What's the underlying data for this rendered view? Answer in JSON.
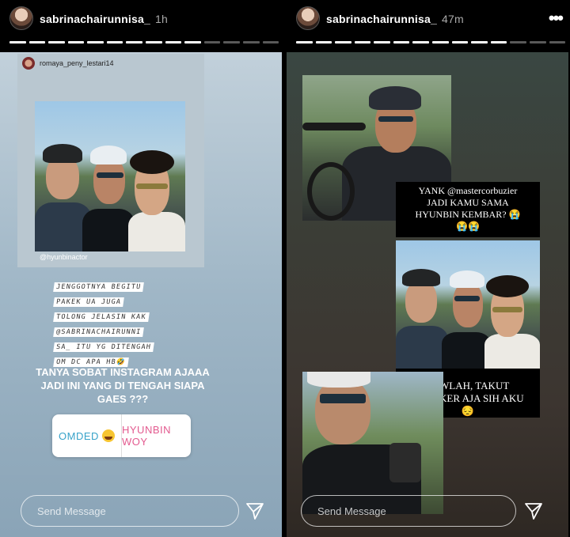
{
  "left_story": {
    "username": "sabrinachairunnisa_",
    "time": "1h",
    "repost_username": "romaya_peny_lestari14",
    "photo_tag": "@hyunbinactor",
    "text_lines": [
      "JENGGOTNYA BEGITU",
      "PAKEK UA JUGA",
      "TOLONG JELASIN KAK",
      "@SABRINACHAIRUNNI",
      "SA_ ITU YG DITENGAH",
      "OM DC APA HB🤣"
    ],
    "question_lines": [
      "TANYA SOBAT INSTAGRAM AJAAA",
      "JADI INI YANG DI TENGAH SIAPA",
      "GAES ???"
    ],
    "poll": {
      "option_a": "OMDED",
      "option_b": "HYUNBIN WOY"
    },
    "send_placeholder": "Send Message"
  },
  "right_story": {
    "username": "sabrinachairunnisa_",
    "time": "47m",
    "caption1_lines": [
      "YANK @mastercorbuzier",
      "JADI KAMU SAMA",
      "HYUNBIN KEMBAR? 😭",
      "😭😭"
    ],
    "caption2_lines": [
      "YAWLAH, TAKUT",
      "KETUKER AJA SIH AKU",
      "😔"
    ],
    "send_placeholder": "Send Message"
  },
  "colors": {
    "poll_a": "#37a2c9",
    "poll_b": "#e35a8f",
    "left_bg": "#9fb6c6",
    "right_bg": "#3b3e37"
  },
  "icons": [
    "more-options-icon",
    "send-direct-icon"
  ]
}
